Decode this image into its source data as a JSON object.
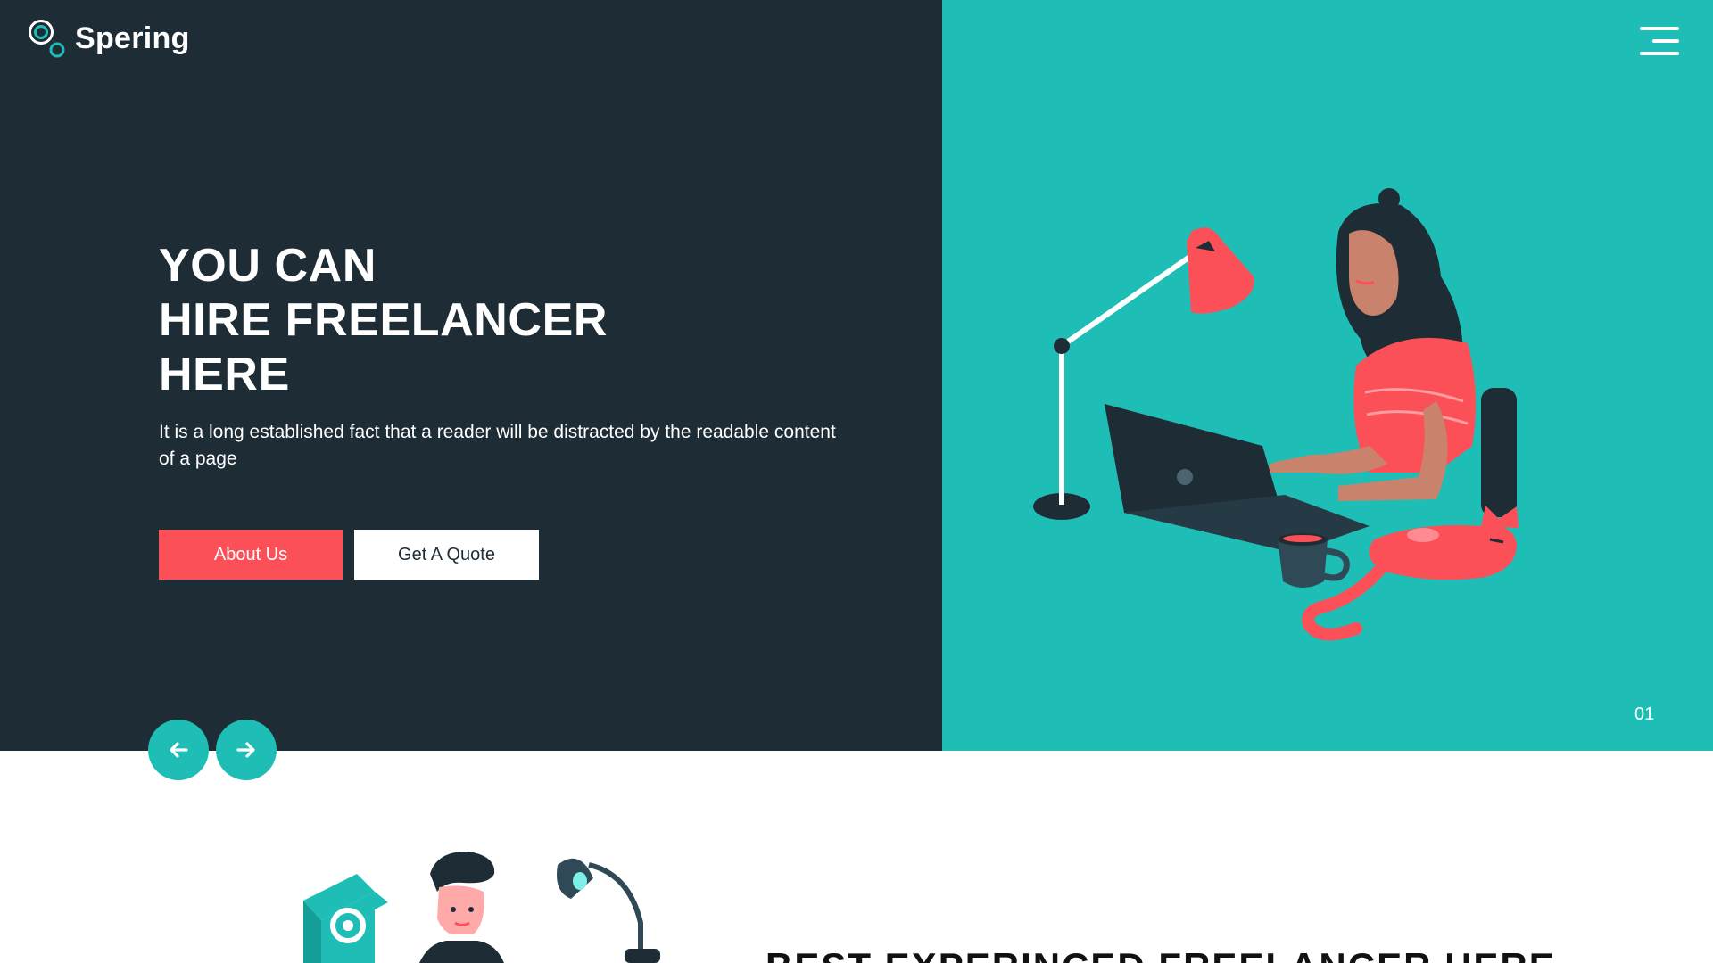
{
  "brand": {
    "name": "Spering",
    "icon": "double-ring-logo-icon"
  },
  "nav": {
    "menu_icon": "hamburger-menu-icon"
  },
  "hero": {
    "title_lines": [
      "YOU CAN",
      "HIRE FREELANCER",
      "HERE"
    ],
    "description": "It is a long established fact that a reader will be distracted by the readable content of a page",
    "about_button": "About Us",
    "quote_button": "Get A Quote",
    "slide_number": "01",
    "prev_icon": "arrow-left-icon",
    "next_icon": "arrow-right-icon",
    "illustration": "woman-working-on-laptop-with-desk-lamp-and-cat-illustration"
  },
  "about": {
    "title": "BEST EXPERINCED FREELANCER HERE",
    "illustration": "man-with-gear-and-desk-lamp-illustration"
  },
  "colors": {
    "dark": "#1e2c35",
    "teal": "#1ebdb6",
    "accent": "#fc5058",
    "white": "#ffffff"
  }
}
